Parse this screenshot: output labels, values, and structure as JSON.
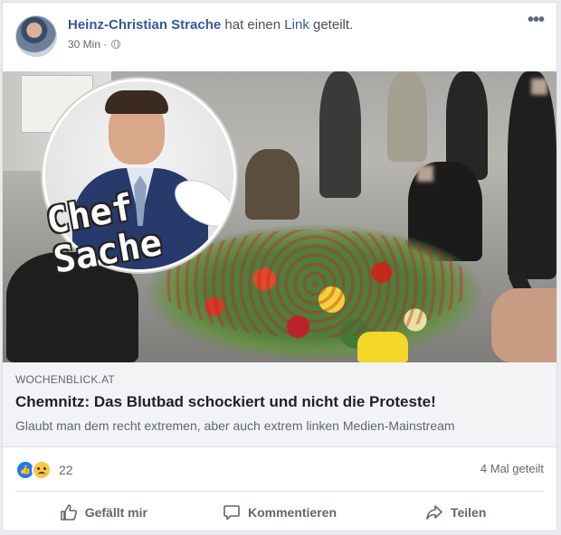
{
  "post": {
    "author": "Heinz-Christian Strache",
    "action_prefix": "hat einen",
    "action_link": "Link",
    "action_suffix": "geteilt.",
    "time": "30 Min",
    "separator": "·",
    "audience_icon": "globe-icon",
    "more_icon": "ellipsis-icon"
  },
  "image": {
    "overlay_text": "Chef\nSache"
  },
  "link": {
    "domain": "WOCHENBLICK.AT",
    "title": "Chemnitz: Das Blutbad schockiert und nicht die Proteste!",
    "description": "Glaubt man dem recht extremen, aber auch extrem linken Medien-Mainstream"
  },
  "stats": {
    "reaction_icons": [
      "like-icon",
      "sad-icon"
    ],
    "reaction_count": "22",
    "shares": "4 Mal geteilt"
  },
  "actions": {
    "like": "Gefällt mir",
    "comment": "Kommentieren",
    "share": "Teilen"
  },
  "colors": {
    "link_blue": "#365899",
    "like_blue": "#2078f4",
    "secondary_text": "#606770",
    "link_preview_bg": "#f2f3f5"
  }
}
